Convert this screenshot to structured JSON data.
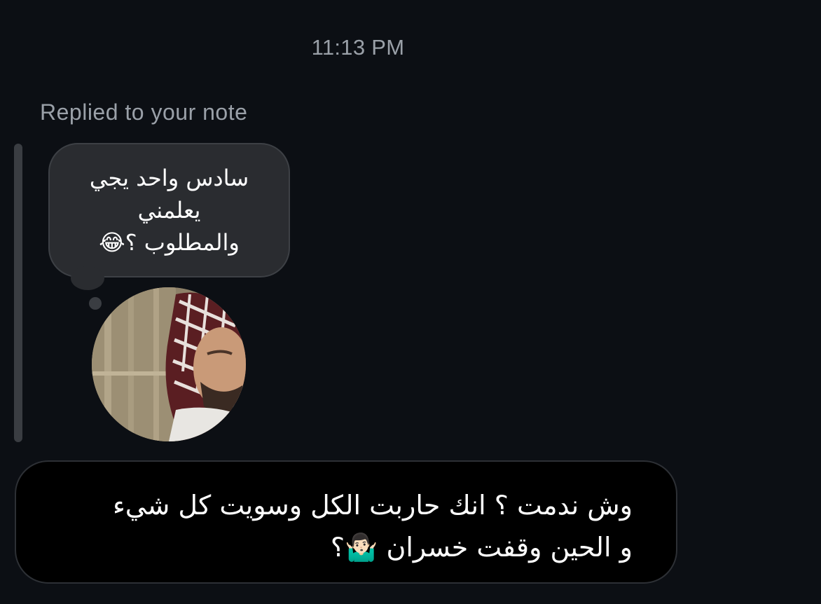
{
  "thread": {
    "timestamp": "11:13 PM",
    "reply_label": "Replied to your note"
  },
  "note": {
    "lines": [
      "سادس واحد يجي",
      "يعلمني",
      "والمطلوب ؟😂"
    ]
  },
  "message": {
    "lines": [
      "وش ندمت ؟ انك حاربت الكل وسويت كل شيء",
      "و الحين وقفت خسران 🤷🏻‍♂️؟"
    ]
  },
  "colors": {
    "background": "#0c0f14",
    "note_bubble": "#2a2c30",
    "message_bubble": "#000000",
    "secondary_text": "#9aa0a8"
  }
}
